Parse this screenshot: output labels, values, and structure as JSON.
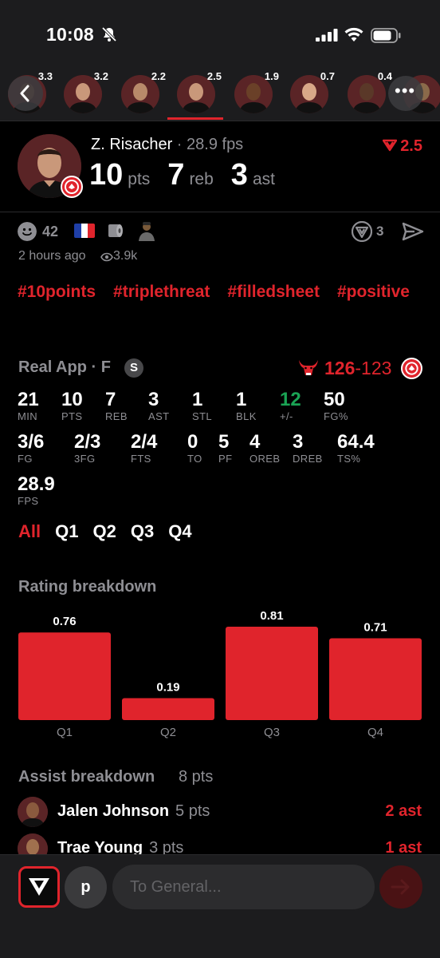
{
  "status_bar": {
    "time": "10:08"
  },
  "player_strip": {
    "items": [
      {
        "value": "3.3"
      },
      {
        "value": "3.2"
      },
      {
        "value": "2.2"
      },
      {
        "value": "2.5"
      },
      {
        "value": "1.9"
      },
      {
        "value": "0.7"
      },
      {
        "value": "0.4"
      },
      {
        "value": ""
      }
    ],
    "active_index": 3
  },
  "header": {
    "name": "Z. Risacher",
    "fps": " · 28.9 fps",
    "rating_delta": "2.5",
    "stats": [
      {
        "value": "10",
        "label": "pts"
      },
      {
        "value": "7",
        "label": "reb"
      },
      {
        "value": "3",
        "label": "ast"
      }
    ]
  },
  "reactions": {
    "count": "42",
    "vote_count": "3",
    "time_ago": "2 hours ago",
    "views": "3.9k"
  },
  "hashtags": [
    "#10points",
    "#triplethreat",
    "#filledsheet",
    "#positive"
  ],
  "game": {
    "title": "Real App · F",
    "badge": "S",
    "score_win": "126",
    "score_sep": "-",
    "score_lose": "123",
    "stats_row1": [
      {
        "value": "21",
        "label": "MIN"
      },
      {
        "value": "10",
        "label": "PTS"
      },
      {
        "value": "7",
        "label": "REB"
      },
      {
        "value": "3",
        "label": "AST"
      },
      {
        "value": "1",
        "label": "STL"
      },
      {
        "value": "1",
        "label": "BLK"
      },
      {
        "value": "12",
        "label": "+/-"
      },
      {
        "value": "50",
        "label": "FG%"
      }
    ],
    "stats_row2": [
      {
        "value": "3/6",
        "label": "FG"
      },
      {
        "value": "2/3",
        "label": "3FG"
      },
      {
        "value": "2/4",
        "label": "FTS"
      },
      {
        "value": "0",
        "label": "TO"
      },
      {
        "value": "5",
        "label": "PF"
      },
      {
        "value": "4",
        "label": "OREB"
      },
      {
        "value": "3",
        "label": "DREB"
      },
      {
        "value": "64.4",
        "label": "TS%"
      }
    ],
    "stats_row3": [
      {
        "value": "28.9",
        "label": "FPS"
      }
    ],
    "tabs": [
      "All",
      "Q1",
      "Q2",
      "Q3",
      "Q4"
    ],
    "active_tab": "All"
  },
  "rating_breakdown": {
    "title": "Rating breakdown"
  },
  "chart_data": {
    "type": "bar",
    "title": "Rating breakdown",
    "categories": [
      "Q1",
      "Q2",
      "Q3",
      "Q4"
    ],
    "values": [
      0.76,
      0.19,
      0.81,
      0.71
    ],
    "ylim": [
      0,
      0.81
    ],
    "color": "#e0242c",
    "grid": false
  },
  "assist_breakdown": {
    "title": "Assist breakdown",
    "subtitle": "8 pts",
    "rows": [
      {
        "name": "Jalen Johnson",
        "pts": "5 pts",
        "ast": "2 ast"
      },
      {
        "name": "Trae Young",
        "pts": "3 pts",
        "ast": "1 ast"
      }
    ]
  },
  "composer": {
    "avatar_letter": "p",
    "placeholder": "To General..."
  },
  "colors": {
    "accent": "#e0242c",
    "positive": "#1aa354",
    "muted": "#8e8e93",
    "background": "#000000"
  }
}
